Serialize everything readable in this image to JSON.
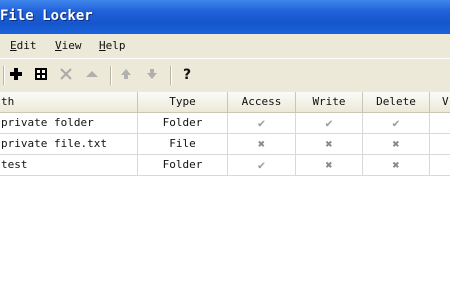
{
  "window": {
    "title": "File Locker"
  },
  "menu": [
    {
      "label": "Edit"
    },
    {
      "label": "View"
    },
    {
      "label": "Help"
    }
  ],
  "toolbar": {
    "icons": [
      "add-icon",
      "grid-icon",
      "delete-icon",
      "eject-icon",
      "move-up-icon",
      "move-down-icon",
      "help-icon"
    ],
    "help_label": "?"
  },
  "table": {
    "columns": [
      "th",
      "Type",
      "Access",
      "Write",
      "Delete",
      "V"
    ],
    "rows": [
      {
        "path": "private folder",
        "type": "Folder",
        "access": "allowed",
        "write": "allowed",
        "delete": "allowed"
      },
      {
        "path": "private file.txt",
        "type": "File",
        "access": "denied",
        "write": "denied",
        "delete": "denied"
      },
      {
        "path": "test",
        "type": "Folder",
        "access": "allowed",
        "write": "denied",
        "delete": "denied"
      }
    ]
  },
  "colors": {
    "titlebar": "#1f5fd8",
    "chrome": "#ece9d8"
  }
}
